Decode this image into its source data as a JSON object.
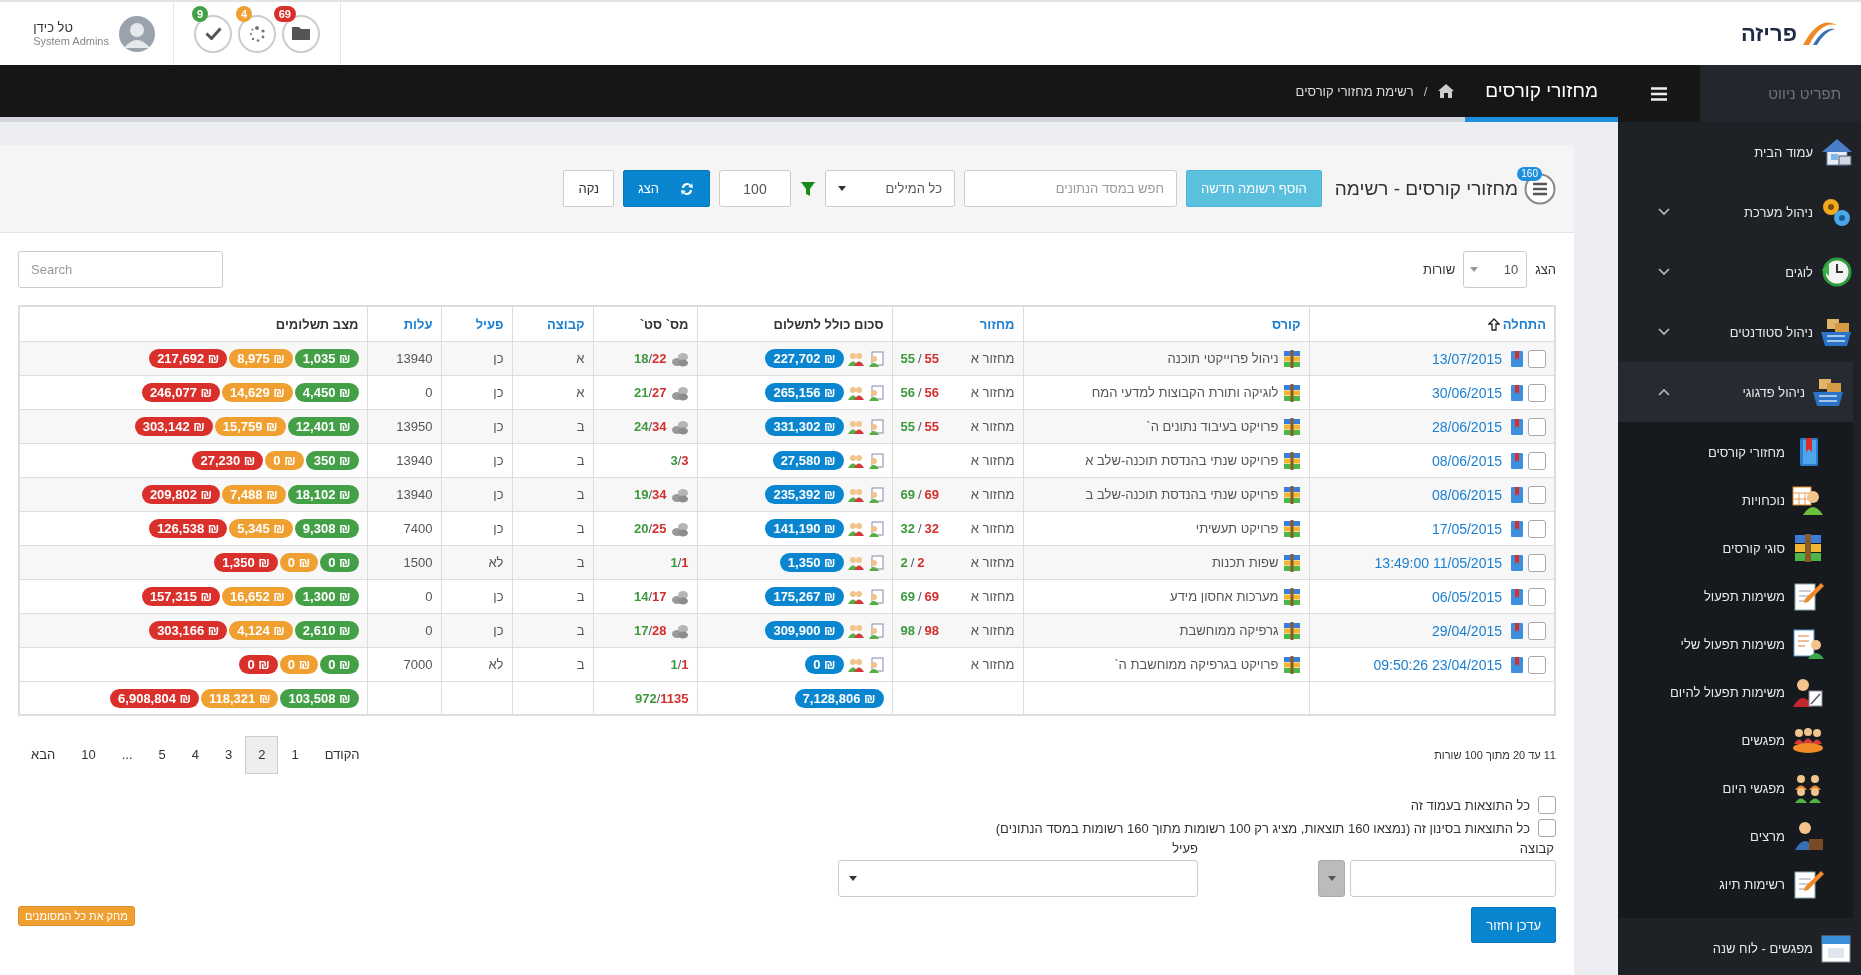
{
  "header": {
    "logo": "פריזה",
    "user": {
      "name": "טל כידן",
      "role": "System Admins"
    },
    "notifications": [
      {
        "count": "69",
        "color": "#d9302c"
      },
      {
        "count": "4",
        "color": "#f0a030"
      },
      {
        "count": "9",
        "color": "#43a047"
      }
    ]
  },
  "navbar": {
    "title": "מחזורי קורסים",
    "separator": "/",
    "breadcrumb": "רשימת מחזורי קורסים"
  },
  "sidebar": {
    "title": "תפריט ניווט",
    "items": [
      {
        "label": "עמוד הבית",
        "kind": "link"
      },
      {
        "label": "ניהול מערכת",
        "kind": "group",
        "expanded": false
      },
      {
        "label": "לוגים",
        "kind": "group",
        "expanded": false
      },
      {
        "label": "ניהול סטודנטים",
        "kind": "group",
        "expanded": false
      },
      {
        "label": "ניהול פדגוגי",
        "kind": "group",
        "expanded": true,
        "children": [
          {
            "label": "מחזורי קורסים"
          },
          {
            "label": "נוכחויות"
          },
          {
            "label": "סוגי קורסים"
          },
          {
            "label": "משימות תפעול"
          },
          {
            "label": "משימות תפעול שלי"
          },
          {
            "label": "משימות תפעול להיום"
          },
          {
            "label": "מפגשים"
          },
          {
            "label": "מפגשי היום"
          },
          {
            "label": "מרצים"
          },
          {
            "label": "רשימות תיוג"
          }
        ]
      },
      {
        "label": "מפגשים - לוח שנה",
        "kind": "link"
      }
    ]
  },
  "toolbar": {
    "title": "מחזורי קורסים - רשימה",
    "record_count": "160",
    "add_button": "הוסף רשומה חדשה",
    "search": {
      "placeholder": "חפש במסד הנתונים"
    },
    "match_mode": "כל המילים",
    "limit": "100",
    "show_button": "הצג",
    "clear_button": "נקה"
  },
  "page_size": {
    "label_before": "הצג",
    "value": "10",
    "label_after": "שורות"
  },
  "table_search": {
    "placeholder": "Search"
  },
  "table": {
    "columns": [
      {
        "label": "התחלה",
        "sortable": true,
        "sorted": true
      },
      {
        "label": "קורס",
        "sortable": true,
        "sorted": false
      },
      {
        "label": "מחזור",
        "sortable": true,
        "sorted": false
      },
      {
        "label": "סכום כולל לתשלום",
        "sortable": false,
        "sorted": false
      },
      {
        "label": "מס` סט`",
        "sortable": false,
        "sorted": false
      },
      {
        "label": "קבוצה",
        "sortable": true,
        "sorted": false
      },
      {
        "label": "פעיל",
        "sortable": true,
        "sorted": false
      },
      {
        "label": "עלות",
        "sortable": true,
        "sorted": false
      },
      {
        "label": "מצב תשלומים",
        "sortable": false,
        "sorted": false
      }
    ],
    "rows": [
      {
        "checked": false,
        "start": "13/07/2015",
        "course": "ניהול פרוייקטי תוכנה",
        "cycle": "מחזור א",
        "registered": [
          "55",
          "/",
          "55"
        ],
        "total": "227,702 ₪",
        "students": [
          "22",
          "/",
          "18"
        ],
        "coins": true,
        "group": "א",
        "active": "כן",
        "cost": "13940",
        "payments": [
          {
            "amount": "1,035 ₪",
            "color": "#43a047"
          },
          {
            "amount": "8,975 ₪",
            "color": "#f0a030"
          },
          {
            "amount": "217,692 ₪",
            "color": "#d9302c"
          }
        ]
      },
      {
        "checked": false,
        "start": "30/06/2015",
        "course": "לוגיקה ותורת הקבוצות למדעי המח",
        "cycle": "מחזור א",
        "registered": [
          "56",
          "/",
          "56"
        ],
        "total": "265,156 ₪",
        "students": [
          "27",
          "/",
          "21"
        ],
        "coins": true,
        "group": "א",
        "active": "כן",
        "cost": "0",
        "payments": [
          {
            "amount": "4,450 ₪",
            "color": "#43a047"
          },
          {
            "amount": "14,629 ₪",
            "color": "#f0a030"
          },
          {
            "amount": "246,077 ₪",
            "color": "#d9302c"
          }
        ]
      },
      {
        "checked": false,
        "start": "28/06/2015",
        "course": "פרויקט בעיבוד נתונים ה`",
        "cycle": "מחזור א",
        "registered": [
          "55",
          "/",
          "55"
        ],
        "total": "331,302 ₪",
        "students": [
          "34",
          "/",
          "24"
        ],
        "coins": true,
        "group": "ב",
        "active": "כן",
        "cost": "13950",
        "payments": [
          {
            "amount": "12,401 ₪",
            "color": "#43a047"
          },
          {
            "amount": "15,759 ₪",
            "color": "#f0a030"
          },
          {
            "amount": "303,142 ₪",
            "color": "#d9302c"
          }
        ]
      },
      {
        "checked": false,
        "start": "08/06/2015",
        "course": "פרויקט שנתי בהנדסת תוכנה-שלב א",
        "cycle": "מחזור א",
        "total": "27,580 ₪",
        "students": [
          "3",
          "/",
          "3"
        ],
        "coins": false,
        "group": "ב",
        "active": "כן",
        "cost": "13940",
        "payments": [
          {
            "amount": "350 ₪",
            "color": "#43a047"
          },
          {
            "amount": "0 ₪",
            "color": "#f0a030"
          },
          {
            "amount": "27,230 ₪",
            "color": "#d9302c"
          }
        ]
      },
      {
        "checked": false,
        "start": "08/06/2015",
        "course": "פרויקט שנתי בהנדסת תוכנה-שלב ב",
        "cycle": "מחזור א",
        "registered": [
          "69",
          "/",
          "69"
        ],
        "total": "235,392 ₪",
        "students": [
          "34",
          "/",
          "19"
        ],
        "coins": true,
        "group": "ב",
        "active": "כן",
        "cost": "13940",
        "payments": [
          {
            "amount": "18,102 ₪",
            "color": "#43a047"
          },
          {
            "amount": "7,488 ₪",
            "color": "#f0a030"
          },
          {
            "amount": "209,802 ₪",
            "color": "#d9302c"
          }
        ]
      },
      {
        "checked": false,
        "start": "17/05/2015",
        "course": "פרויקט תעשיתי",
        "cycle": "מחזור א",
        "registered": [
          "32",
          "/",
          "32"
        ],
        "total": "141,190 ₪",
        "students": [
          "25",
          "/",
          "20"
        ],
        "coins": true,
        "group": "ב",
        "active": "כן",
        "cost": "7400",
        "payments": [
          {
            "amount": "9,308 ₪",
            "color": "#43a047"
          },
          {
            "amount": "5,345 ₪",
            "color": "#f0a030"
          },
          {
            "amount": "126,538 ₪",
            "color": "#d9302c"
          }
        ]
      },
      {
        "checked": false,
        "start": "13:49:00 11/05/2015",
        "course": "שפות תכנות",
        "cycle": "מחזור א",
        "registered": [
          "2",
          "/",
          "2"
        ],
        "total": "1,350 ₪",
        "students": [
          "1",
          "/",
          "1"
        ],
        "coins": false,
        "group": "ב",
        "active": "לא",
        "cost": "1500",
        "payments": [
          {
            "amount": "0 ₪",
            "color": "#43a047"
          },
          {
            "amount": "0 ₪",
            "color": "#f0a030"
          },
          {
            "amount": "1,350 ₪",
            "color": "#d9302c"
          }
        ]
      },
      {
        "checked": false,
        "start": "06/05/2015",
        "course": "מערכות אחסון מידע",
        "cycle": "מחזור א",
        "registered": [
          "69",
          "/",
          "69"
        ],
        "total": "175,267 ₪",
        "students": [
          "17",
          "/",
          "14"
        ],
        "coins": true,
        "group": "ב",
        "active": "כן",
        "cost": "0",
        "payments": [
          {
            "amount": "1,300 ₪",
            "color": "#43a047"
          },
          {
            "amount": "16,652 ₪",
            "color": "#f0a030"
          },
          {
            "amount": "157,315 ₪",
            "color": "#d9302c"
          }
        ]
      },
      {
        "checked": false,
        "start": "29/04/2015",
        "course": "גרפיקה ממוחשבת",
        "cycle": "מחזור א",
        "registered": [
          "98",
          "/",
          "98"
        ],
        "total": "309,900 ₪",
        "students": [
          "28",
          "/",
          "17"
        ],
        "coins": true,
        "group": "ב",
        "active": "כן",
        "cost": "0",
        "payments": [
          {
            "amount": "2,610 ₪",
            "color": "#43a047"
          },
          {
            "amount": "4,124 ₪",
            "color": "#f0a030"
          },
          {
            "amount": "303,166 ₪",
            "color": "#d9302c"
          }
        ]
      },
      {
        "checked": false,
        "start": "09:50:26 23/04/2015",
        "course": "פרויקט בגרפיקה ממוחשבת ה`",
        "cycle": "מחזור א",
        "total": "0 ₪",
        "students": [
          "1",
          "/",
          "1"
        ],
        "coins": false,
        "group": "ב",
        "active": "לא",
        "cost": "7000",
        "payments": [
          {
            "amount": "0 ₪",
            "color": "#43a047"
          },
          {
            "amount": "0 ₪",
            "color": "#f0a030"
          },
          {
            "amount": "0 ₪",
            "color": "#d9302c"
          }
        ]
      }
    ],
    "totals": {
      "total": "7,128,806 ₪",
      "students": [
        "1135",
        "/",
        "972"
      ],
      "payments": [
        {
          "amount": "103,508 ₪",
          "color": "#43a047"
        },
        {
          "amount": "118,321 ₪",
          "color": "#f0a030"
        },
        {
          "amount": "6,908,804 ₪",
          "color": "#d9302c"
        }
      ]
    }
  },
  "footer": {
    "summary": "11 עד 20 מתוך 100 שורות",
    "pagination": [
      {
        "label": "הקודם",
        "selected": false
      },
      {
        "label": "1",
        "selected": false
      },
      {
        "label": "2",
        "selected": true
      },
      {
        "label": "3",
        "selected": false
      },
      {
        "label": "4",
        "selected": false
      },
      {
        "label": "5",
        "selected": false
      },
      {
        "label": "...",
        "selected": false
      },
      {
        "label": "10",
        "selected": false
      },
      {
        "label": "הבא",
        "selected": false
      }
    ]
  },
  "bulk": {
    "options": [
      {
        "label": "כל התוצאות בעמוד זה",
        "checked": false
      },
      {
        "label": "כל התוצאות בסינון זה (נמצאו 160 תוצאות, מציג רק 100 רשומות מתוך 160 רשומות במסד הנתונים)",
        "checked": false
      }
    ],
    "fields": [
      {
        "label": "קבוצה",
        "kind": "combo"
      },
      {
        "label": "פעיל",
        "kind": "select"
      }
    ],
    "update_button": "עדכן וחזור",
    "delete_button": "מחק את כל המסומנים"
  }
}
